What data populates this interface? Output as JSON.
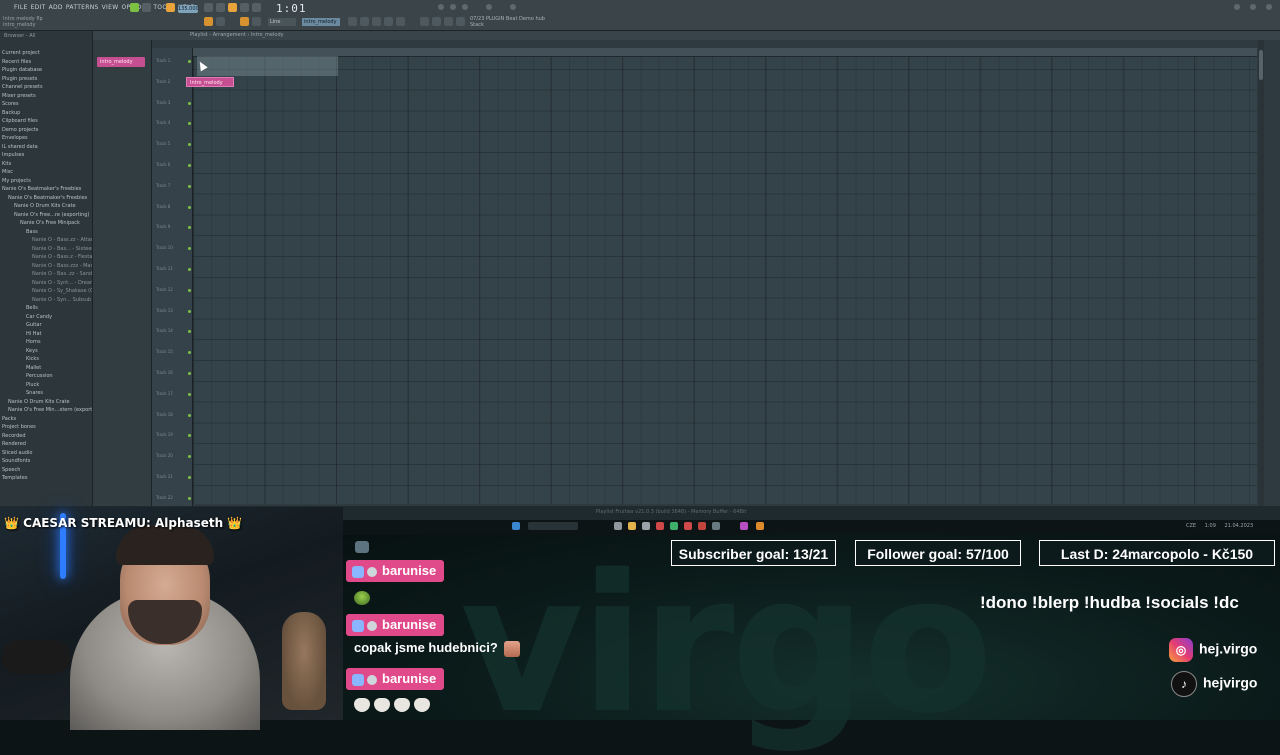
{
  "fl": {
    "menu": [
      "FILE",
      "EDIT",
      "ADD",
      "PATTERNS",
      "VIEW",
      "OPTIONS",
      "TOOLS",
      "HELP"
    ],
    "project_name": [
      "Intro melody flp",
      "intro_melody"
    ],
    "tempo": "135.000",
    "time": "1:01",
    "time_small": "000",
    "snap": "Line",
    "pattern": "intro_melody",
    "plugin_info": [
      "07/23 PLUGIN Beat Demo hub",
      "Stack"
    ],
    "browser_head": "Browser - All",
    "browser_items": [
      {
        "label": "Current project",
        "lvl": 0
      },
      {
        "label": "Recent files",
        "lvl": 0
      },
      {
        "label": "Plugin database",
        "lvl": 0
      },
      {
        "label": "Plugin presets",
        "lvl": 0
      },
      {
        "label": "Channel presets",
        "lvl": 0
      },
      {
        "label": "Mixer presets",
        "lvl": 0
      },
      {
        "label": "Scores",
        "lvl": 0
      },
      {
        "label": "Backup",
        "lvl": 0
      },
      {
        "label": "Clipboard files",
        "lvl": 0
      },
      {
        "label": "Demo projects",
        "lvl": 0
      },
      {
        "label": "Envelopes",
        "lvl": 0
      },
      {
        "label": "IL shared data",
        "lvl": 0
      },
      {
        "label": "Impulses",
        "lvl": 0
      },
      {
        "label": "Kits",
        "lvl": 0
      },
      {
        "label": "Misc",
        "lvl": 0
      },
      {
        "label": "My projects",
        "lvl": 0
      },
      {
        "label": "Nanie O's Beatmaker's Freebies",
        "lvl": 0
      },
      {
        "label": "Nanie O's Beatmaker's Freebies",
        "lvl": 1
      },
      {
        "label": "Nanie O Drum Kits Crate",
        "lvl": 2
      },
      {
        "label": "Nanie O's Free...re (exporting)",
        "lvl": 2
      },
      {
        "label": "Nanie O's Free Minipack",
        "lvl": 3
      },
      {
        "label": "Bass",
        "lvl": 4
      },
      {
        "label": "Nanie O - Bass.zz - Attack (C)",
        "lvl": 5
      },
      {
        "label": "Nanie O - Bas... - Sixteen (C)",
        "lvl": 5
      },
      {
        "label": "Nanie O - Bass.z - Fiesta (C)",
        "lvl": 5
      },
      {
        "label": "Nanie O - Bass.zzz - Mac (C)",
        "lvl": 5
      },
      {
        "label": "Nanie O - Bas..zz - Sand (C)",
        "lvl": 5
      },
      {
        "label": "Nanie O - Synt... - Dream (C)",
        "lvl": 5
      },
      {
        "label": "Nanie O - Sy_Shakase (C)",
        "lvl": 5,
        "hl": true
      },
      {
        "label": "Nanie O - Syn... Subsub (C)",
        "lvl": 5
      },
      {
        "label": "Bells",
        "lvl": 4
      },
      {
        "label": "Car Candy",
        "lvl": 4
      },
      {
        "label": "Guitar",
        "lvl": 4
      },
      {
        "label": "Hi Hat",
        "lvl": 4
      },
      {
        "label": "Horns",
        "lvl": 4
      },
      {
        "label": "Keys",
        "lvl": 4
      },
      {
        "label": "Kicks",
        "lvl": 4
      },
      {
        "label": "Mallet",
        "lvl": 4
      },
      {
        "label": "Percussion",
        "lvl": 4
      },
      {
        "label": "Pluck",
        "lvl": 4
      },
      {
        "label": "Snares",
        "lvl": 4
      },
      {
        "label": "Nanie O Drum Kits Crate",
        "lvl": 1
      },
      {
        "label": "Nanie O's Free Min...xtern (exporting)",
        "lvl": 1
      },
      {
        "label": "Packs",
        "lvl": 0
      },
      {
        "label": "Project bones",
        "lvl": 0
      },
      {
        "label": "Recorded",
        "lvl": 0
      },
      {
        "label": "Rendered",
        "lvl": 0
      },
      {
        "label": "Sliced audio",
        "lvl": 0
      },
      {
        "label": "Soundfonts",
        "lvl": 0
      },
      {
        "label": "Speech",
        "lvl": 0
      },
      {
        "label": "Templates",
        "lvl": 0
      }
    ],
    "picker_pattern": "intro_melody",
    "playlist_title": "Playlist - Arrangement › Intro_melody",
    "clip_label": "Intro_melody",
    "tracks": [
      "Track 1",
      "Track 2",
      "Track 3",
      "Track 4",
      "Track 5",
      "Track 6",
      "Track 7",
      "Track 8",
      "Track 9",
      "Track 10",
      "Track 11",
      "Track 12",
      "Track 13",
      "Track 14",
      "Track 15",
      "Track 16",
      "Track 17",
      "Track 18",
      "Track 19",
      "Track 20",
      "Track 21",
      "Track 22"
    ],
    "status_text": "Playlist Fruities v21.0.3 (build 3648) - Memory Buffer - 64Bit",
    "tray": [
      "CZE",
      "1:09",
      "21.04.2023"
    ]
  },
  "stream": {
    "headline": "CAESAR STREAMU: Alphaseth",
    "crown": "👑",
    "goals": {
      "subscriber": "Subscriber goal: 13/21",
      "follower": "Follower goal: 57/100",
      "last_donation": "Last D: 24marcopolo - Kč150"
    },
    "commands": "!dono !blerp !hudba !socials !dc",
    "socials": {
      "instagram": "hej.virgo",
      "tiktok": "hejvirgo",
      "instagram_icon": "instagram-icon",
      "tiktok_icon": "tiktok-icon"
    },
    "chat": [
      {
        "user": "barunise",
        "message": ""
      },
      {
        "user": "barunise",
        "message": "copak jsme hudebnici?"
      },
      {
        "user": "barunise",
        "message": ""
      }
    ],
    "colors": {
      "chat_badge": "#e14a8a",
      "clip": "#c64f92",
      "neon": "#2f7dff"
    }
  }
}
